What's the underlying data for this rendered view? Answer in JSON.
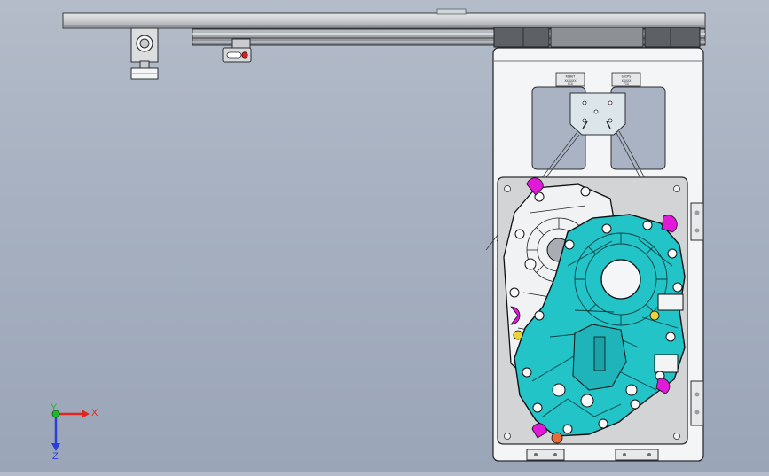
{
  "viewport": {
    "background_top": "#b4bcc9",
    "background_bottom": "#9aa5b8"
  },
  "colors": {
    "housing_cyan": "#22c4c8",
    "housing_outline": "#111111",
    "cover_white": "#f1f2f4",
    "plate_grey": "#d3d4d6",
    "frame_white": "#f4f5f6",
    "bolt_magenta": "#e01ad8",
    "bolt_yellow": "#e9d43a",
    "bolt_orange": "#e86b3a",
    "axis_x": "#e0261f",
    "axis_y": "#1fb72c",
    "axis_z": "#2a3fd6"
  },
  "model": {
    "top_beam": "horizontal-beam",
    "sensor_left": "sensor-mount",
    "carriage": "linear-slide-carriage",
    "frame": "fixture-frame",
    "plates": [
      {
        "line1": "ROBOT",
        "line2": "XXXXXX",
        "line3": "FIX"
      },
      {
        "line1": "GRIPS",
        "line2": "XXXXX",
        "line3": "FIX"
      }
    ]
  },
  "triad": {
    "x_label": "X",
    "y_label": "Y",
    "z_label": "Z"
  }
}
